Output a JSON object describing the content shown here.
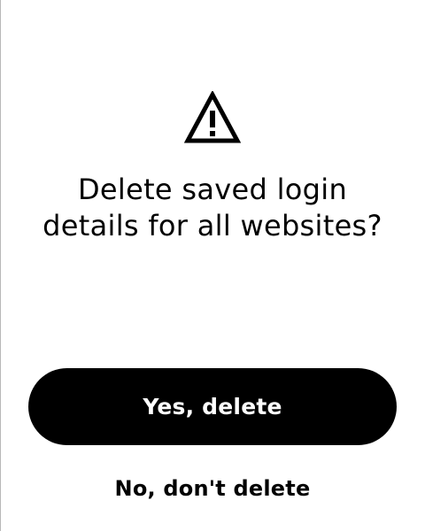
{
  "dialog": {
    "icon": "warning-triangle-icon",
    "title": "Delete saved login details for all websites?",
    "confirm_label": "Yes, delete",
    "cancel_label": "No, don't delete"
  },
  "colors": {
    "background": "#ffffff",
    "text": "#000000",
    "primary_button_background": "#000000",
    "primary_button_text": "#ffffff"
  }
}
